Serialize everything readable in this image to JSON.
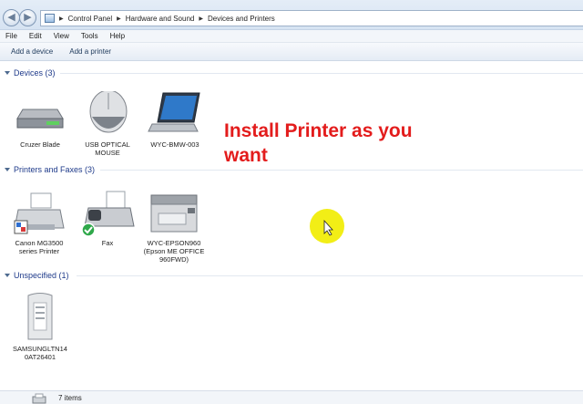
{
  "breadcrumb": [
    "Control Panel",
    "Hardware and Sound",
    "Devices and Printers"
  ],
  "menu": [
    "File",
    "Edit",
    "View",
    "Tools",
    "Help"
  ],
  "toolbar": {
    "add_device": "Add a device",
    "add_printer": "Add a printer"
  },
  "groups": {
    "devices": {
      "title": "Devices (3)",
      "items": [
        "Cruzer Blade",
        "USB OPTICAL MOUSE",
        "WYC-BMW-003"
      ]
    },
    "printers": {
      "title": "Printers and Faxes (3)",
      "items": [
        "Canon MG3500 series Printer",
        "Fax",
        "WYC-EPSON960 (Epson ME OFFICE 960FWD)"
      ]
    },
    "unspecified": {
      "title": "Unspecified (1)",
      "items": [
        "SAMSUNGLTN140AT26401"
      ]
    }
  },
  "status": {
    "count": "7 items"
  },
  "overlay_text": "Install Printer as you want",
  "colors": {
    "overlay": "#e31c1c",
    "cursor_highlight": "#f2ee16",
    "group_title": "#1e3a8a"
  }
}
